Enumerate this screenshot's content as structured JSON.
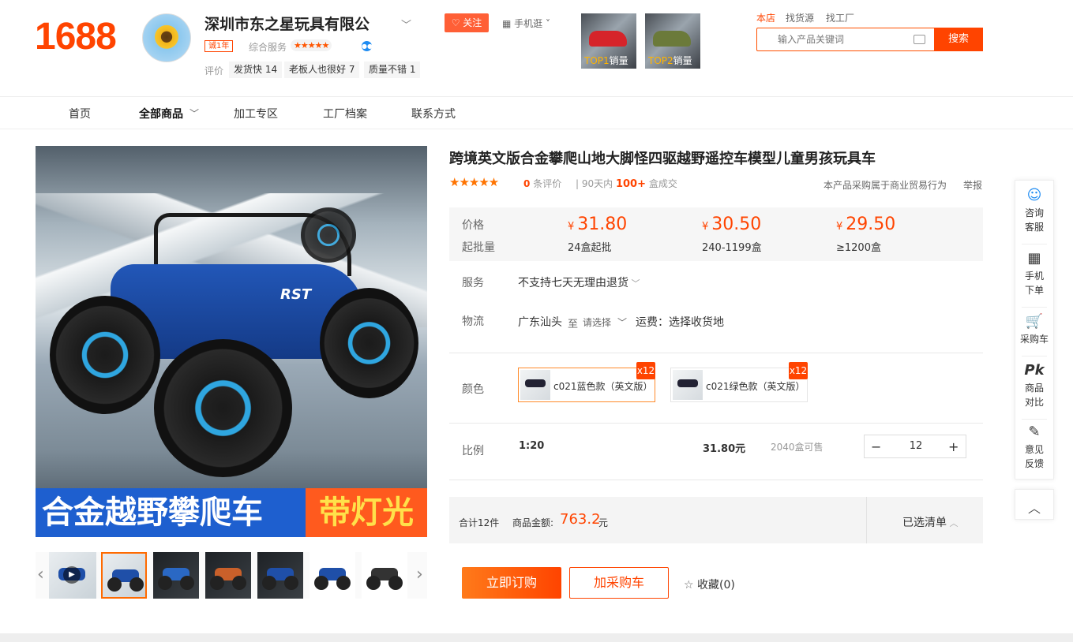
{
  "header": {
    "logo": "1688",
    "shop_name": "深圳市东之星玩具有限公",
    "year_badge": "诚1年",
    "service_label": "综合服务",
    "service_stars": "★★★★★",
    "eval_label": "评价",
    "eval_chips": [
      "发货快 14",
      "老板人也很好 7",
      "质量不错 1"
    ],
    "follow_label": "关注",
    "mobile_label": "手机逛",
    "top_products": [
      {
        "rank": "TOP1",
        "label": "销量"
      },
      {
        "rank": "TOP2",
        "label": "销量"
      }
    ],
    "search_tabs": [
      "本店",
      "找货源",
      "找工厂"
    ],
    "search_placeholder": "输入产品关键词",
    "search_button": "搜索"
  },
  "nav": {
    "items": [
      "首页",
      "全部商品",
      "加工专区",
      "工厂档案",
      "联系方式"
    ]
  },
  "gallery": {
    "banner_left": "合金越野攀爬车",
    "banner_right": "带灯光",
    "car_brand": "RST",
    "thumb_count": 7
  },
  "product": {
    "title": "跨境英文版合金攀爬山地大脚怪四驱越野遥控车模型儿童男孩玩具车",
    "rating_stars": "★★★★★",
    "review_count": "0",
    "review_unit": "条评价",
    "deal_prefix": "90天内",
    "deal_count": "100+",
    "deal_unit": "盒成交",
    "biz_note": "本产品采购属于商业贸易行为",
    "report": "举报",
    "price_label": "价格",
    "moq_label": "起批量",
    "currency": "¥",
    "tiers": [
      {
        "price": "31.80",
        "qty": "24盒起批"
      },
      {
        "price": "30.50",
        "qty": "240-1199盒"
      },
      {
        "price": "29.50",
        "qty": "≥1200盒"
      }
    ],
    "service_label": "服务",
    "service_value": "不支持七天无理由退货",
    "logistics_label": "物流",
    "origin": "广东汕头",
    "to": "至",
    "select_dest": "请选择",
    "shipping": "运费：选择收货地",
    "color_label": "颜色",
    "colors": [
      {
        "name": "c021蓝色款（英文版）",
        "badge": "x12"
      },
      {
        "name": "c021绿色款（英文版）",
        "badge": "x12"
      }
    ],
    "scale_label": "比例",
    "scale_value": "1:20",
    "unit_price": "31.80元",
    "stock": "2040盒可售",
    "quantity": "12",
    "total_count": "合计12件",
    "amount_label": "商品金额:",
    "amount": "763.2",
    "amount_unit": "元",
    "selected_list": "已选清单",
    "buy_now": "立即订购",
    "add_cart": "加采购车",
    "favorite": "收藏(0)"
  },
  "sidebar": {
    "items": [
      {
        "label": "咨询客服",
        "icon": "chat-icon"
      },
      {
        "label": "手机下单",
        "icon": "qrcode-icon"
      },
      {
        "label": "采购车",
        "icon": "cart-icon"
      },
      {
        "label": "商品对比",
        "icon": "compare-icon"
      },
      {
        "label": "意见反馈",
        "icon": "edit-icon"
      }
    ]
  },
  "colors": {
    "brand": "#ff4400",
    "follow": "#ff5f36"
  }
}
